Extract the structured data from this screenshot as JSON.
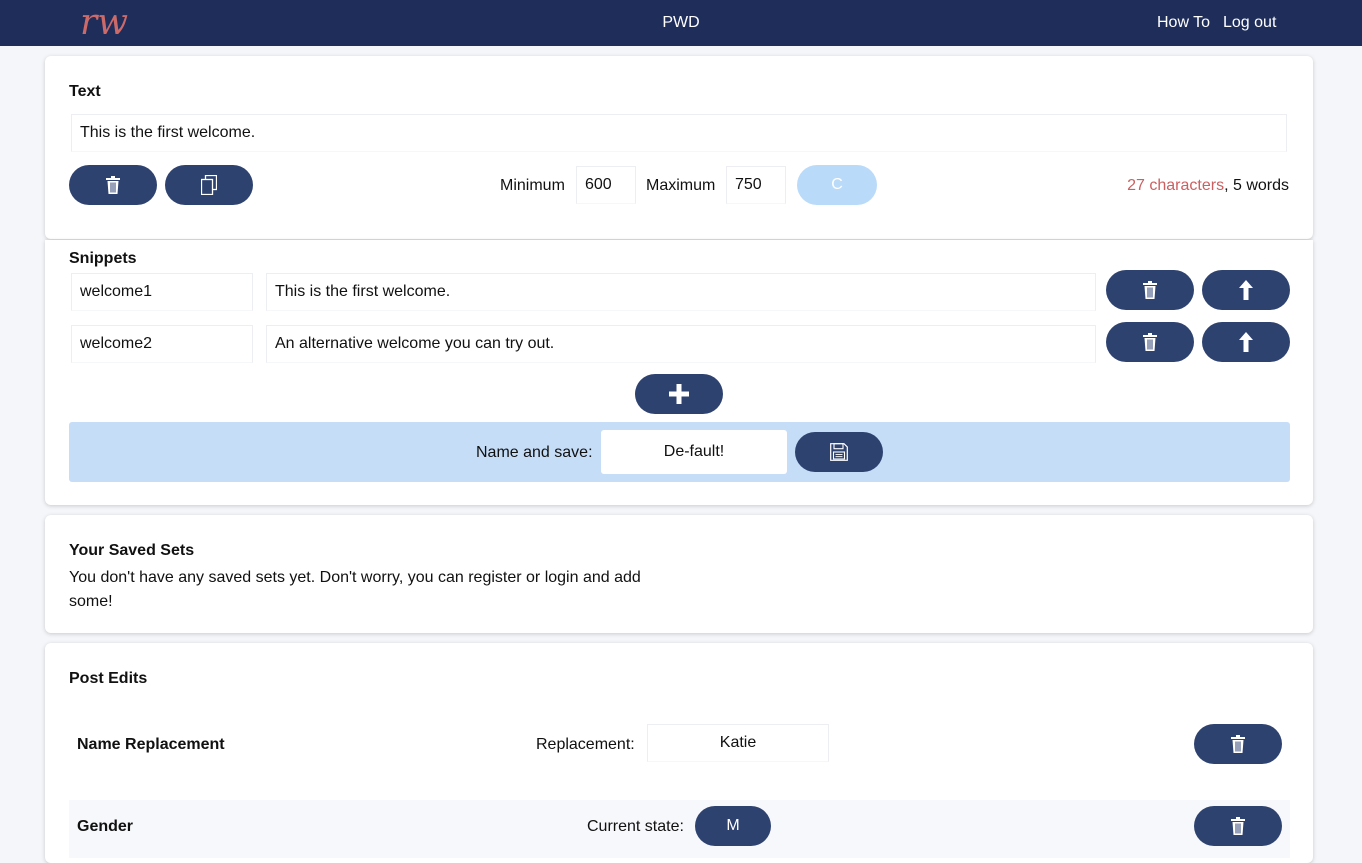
{
  "header": {
    "logo_text": "rw",
    "title": "PWD",
    "nav": {
      "how_to": "How To",
      "log_out": "Log out"
    },
    "colors": {
      "background": "#1e2d5a",
      "logo": "#cc6a6a"
    }
  },
  "text_section": {
    "heading": "Text",
    "value": "This is the first welcome.",
    "buttons": {
      "delete_icon": "trash-icon",
      "copy_icon": "copy-icon"
    },
    "minimum_label": "Minimum",
    "minimum_value": "600",
    "maximum_label": "Maximum",
    "maximum_value": "750",
    "check_button_label": "C",
    "character_count": "27 characters",
    "separator": ",",
    "word_count": "5 words"
  },
  "snippets_section": {
    "heading": "Snippets",
    "items": [
      {
        "name": "welcome1",
        "text": "This is the first welcome."
      },
      {
        "name": "welcome2",
        "text": "An alternative welcome you can try out."
      }
    ],
    "add_icon": "plus-icon",
    "save_label": "Name and save:",
    "save_name_value": "De-fault!",
    "save_icon": "floppy-disk-icon"
  },
  "saved_sets": {
    "heading": "Your Saved Sets",
    "message_line1": "You don't have any saved sets yet. Don't worry, you can register or login and add",
    "message_line2": "some!"
  },
  "post_edits": {
    "heading": "Post Edits",
    "name_replacement": {
      "title": "Name Replacement",
      "label": "Replacement:",
      "value": "Katie"
    },
    "gender": {
      "title": "Gender",
      "label": "Current state:",
      "state": "M"
    }
  },
  "colors": {
    "accent": "#2e4270",
    "warning_text": "#cc5f5f",
    "disabled_button": "#b9daf8",
    "save_bar": "#c6ddf8"
  }
}
